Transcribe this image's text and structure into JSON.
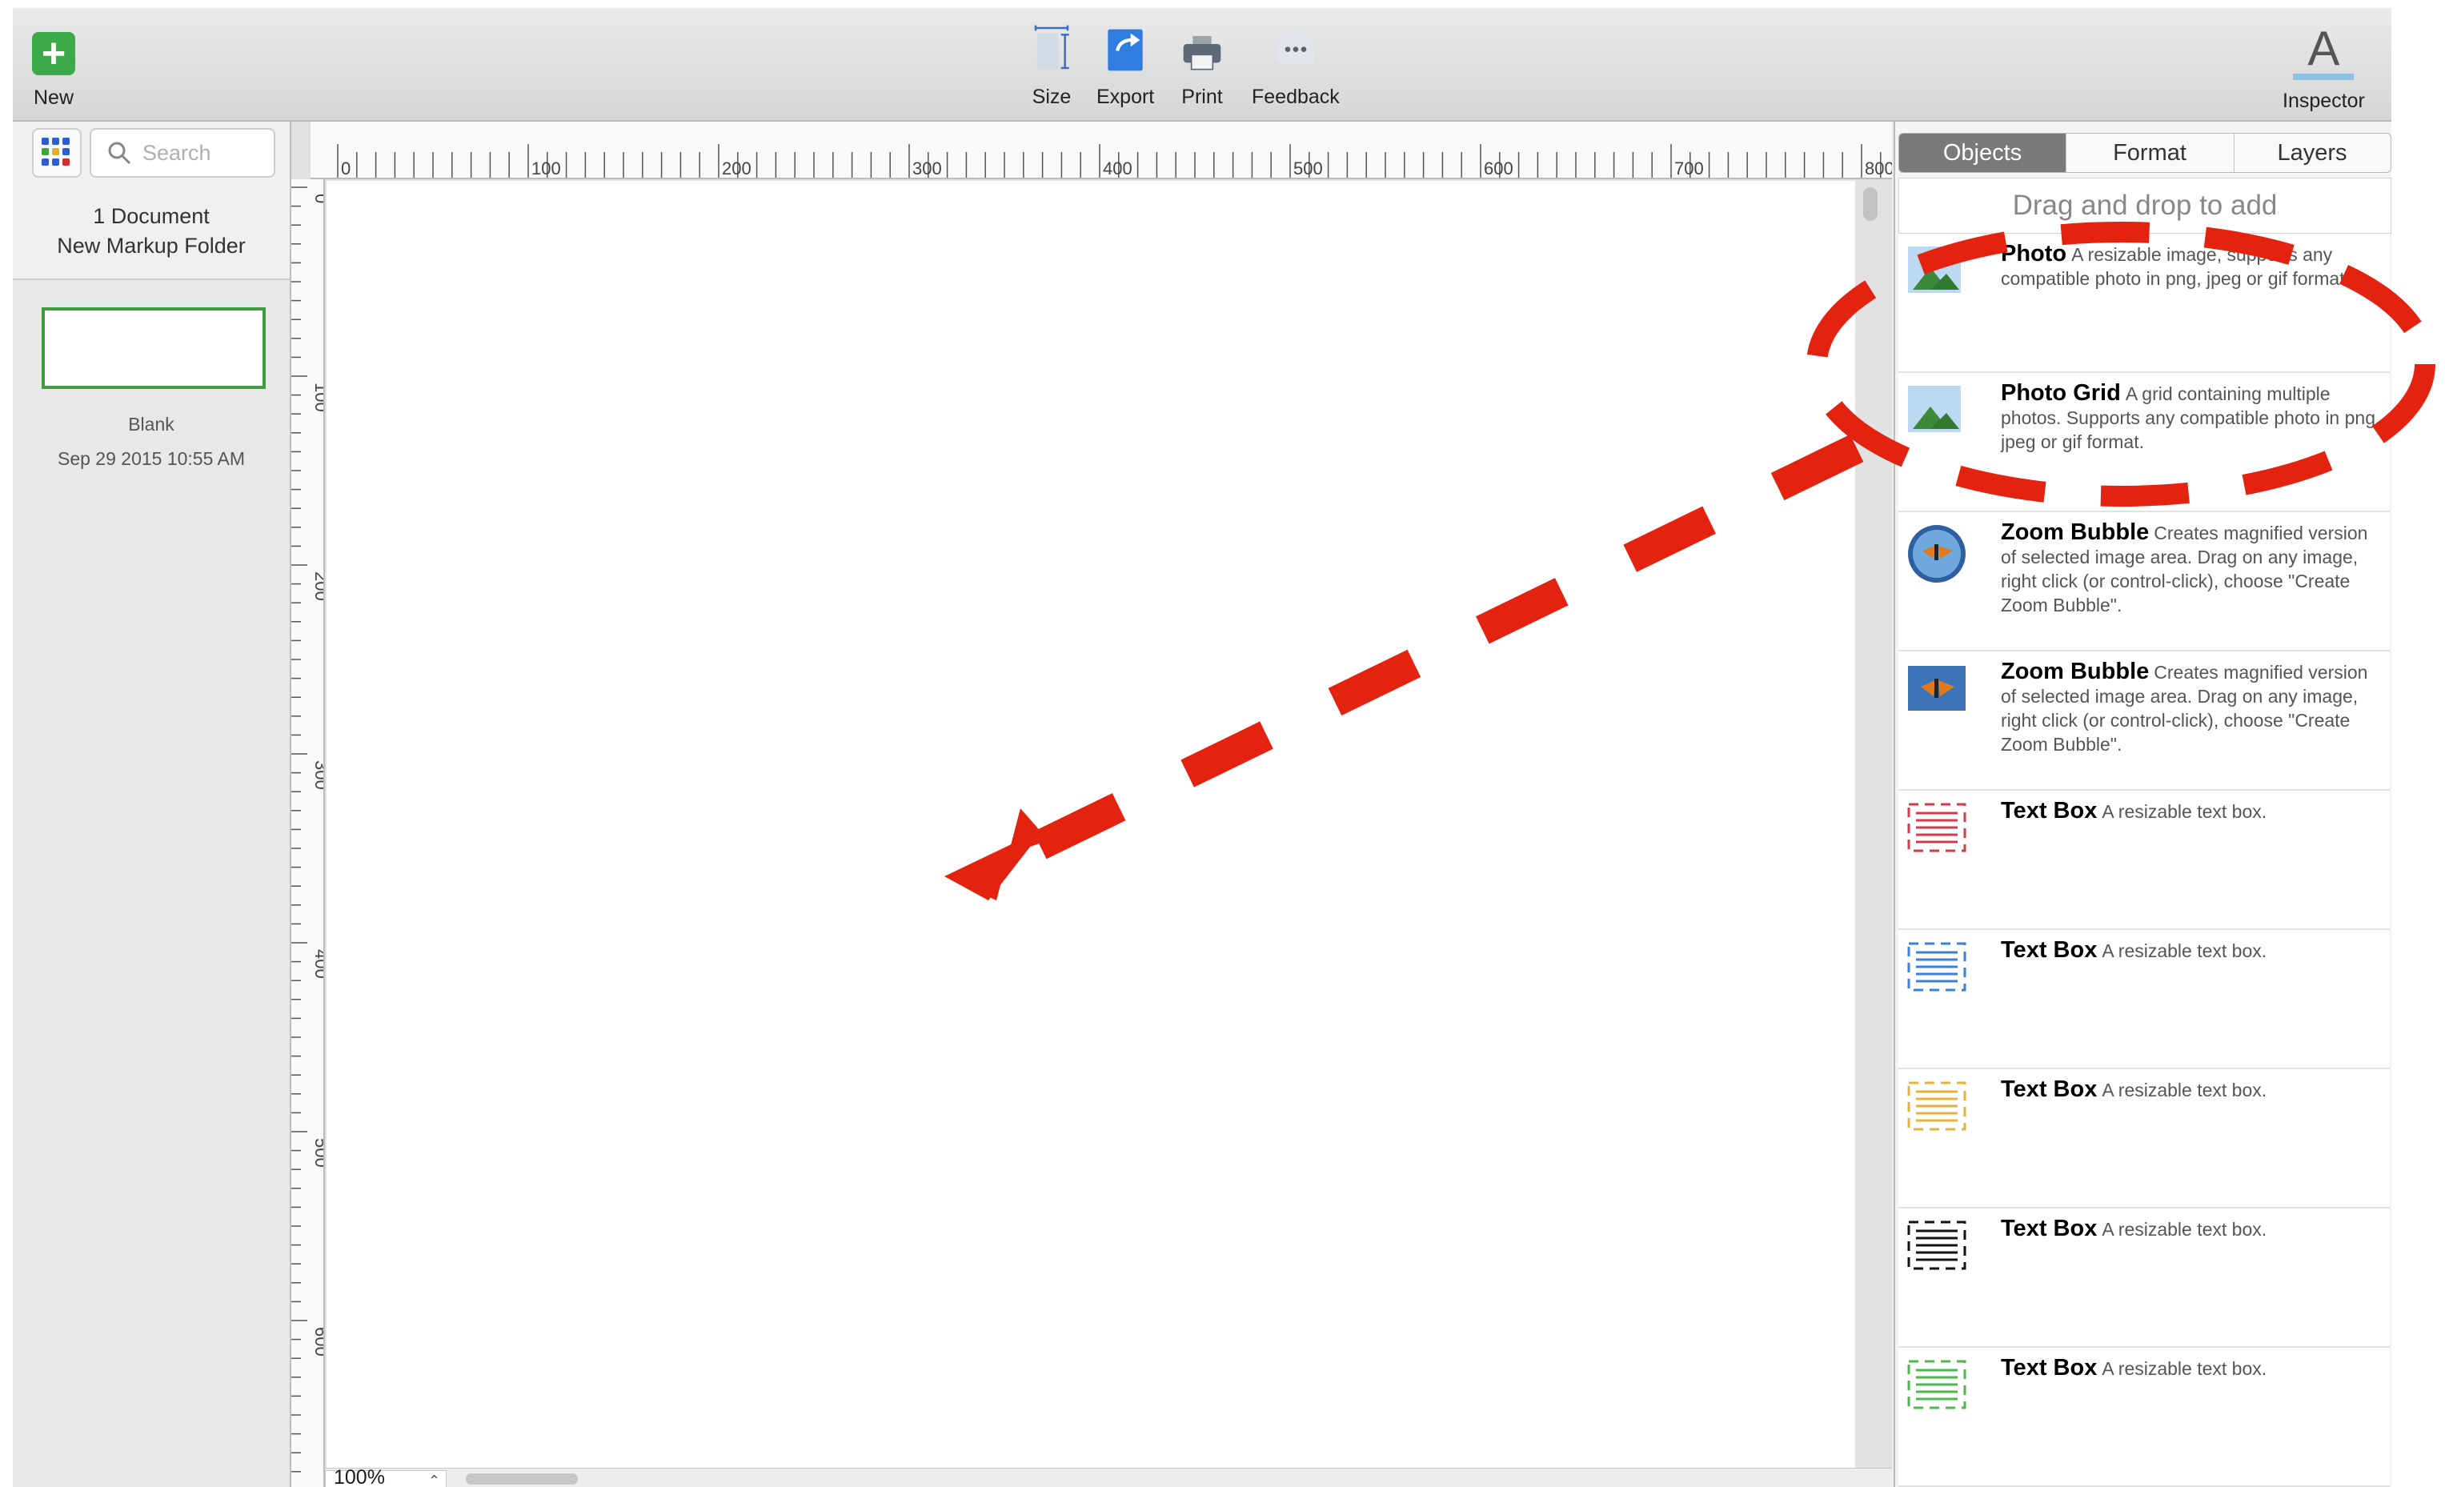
{
  "toolbar": {
    "new_label": "New",
    "size_label": "Size",
    "export_label": "Export",
    "print_label": "Print",
    "feedback_label": "Feedback",
    "inspector_label": "Inspector",
    "inspector_glyph": "A"
  },
  "sidebar": {
    "search_placeholder": "Search",
    "doc_count": "1 Document",
    "folder_name": "New Markup Folder",
    "documents": [
      {
        "name": "Blank",
        "date": "Sep 29 2015 10:55 AM"
      }
    ]
  },
  "canvas": {
    "ruler_h_labels": [
      "0",
      "100",
      "200",
      "300",
      "400",
      "500",
      "600",
      "700",
      "800"
    ],
    "ruler_v_labels": [
      "0",
      "100",
      "200",
      "300",
      "400",
      "500",
      "600"
    ],
    "zoom": "100%"
  },
  "panel": {
    "tabs": [
      "Objects",
      "Format",
      "Layers"
    ],
    "active_tab": "Objects",
    "drag_hint": "Drag and drop to add",
    "objects": [
      {
        "title": "Photo",
        "desc": "A resizable image, supports any compatible photo in png, jpeg or gif format.",
        "icon": "photo-icon"
      },
      {
        "title": "Photo Grid",
        "desc": "A grid containing multiple photos.  Supports any compatible photo in png, jpeg or gif format.",
        "icon": "photo-grid-icon"
      },
      {
        "title": "Zoom Bubble",
        "desc": "Creates magnified version of selected image area.  Drag on any image, right click (or control-click), choose \"Create Zoom Bubble\".",
        "icon": "zoom-bubble-round-icon"
      },
      {
        "title": "Zoom Bubble",
        "desc": "Creates magnified version of selected image area.  Drag on any image, right click (or control-click), choose \"Create Zoom Bubble\".",
        "icon": "zoom-bubble-square-icon"
      },
      {
        "title": "Text Box",
        "desc": "A resizable text box.",
        "icon": "text-box-icon",
        "color": "#d23a4e"
      },
      {
        "title": "Text Box",
        "desc": "A resizable text box.",
        "icon": "text-box-icon",
        "color": "#3a7fd9"
      },
      {
        "title": "Text Box",
        "desc": "A resizable text box.",
        "icon": "text-box-icon",
        "color": "#e8b23a"
      },
      {
        "title": "Text Box",
        "desc": "A resizable text box.",
        "icon": "text-box-icon",
        "color": "#111111"
      },
      {
        "title": "Text Box",
        "desc": "A resizable text box.",
        "icon": "text-box-icon",
        "color": "#4cb84c"
      }
    ]
  },
  "colors": {
    "annotation": "#e3230f",
    "new_button": "#3daa4a",
    "thumbnail_border": "#3f9c3f"
  }
}
